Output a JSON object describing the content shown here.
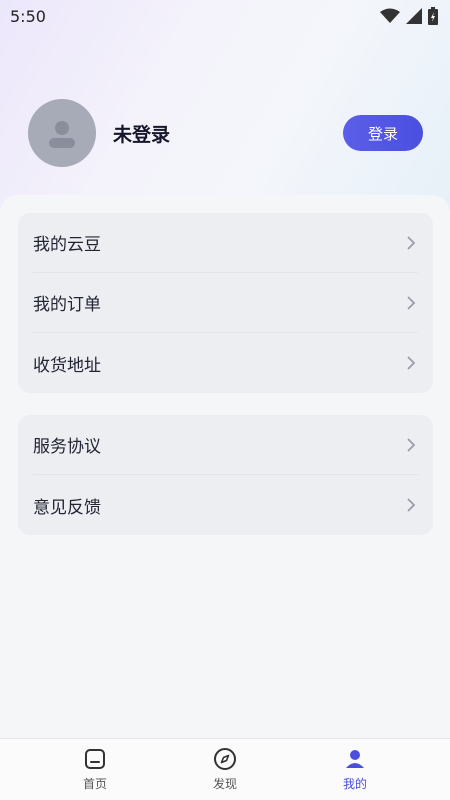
{
  "status": {
    "time": "5:50"
  },
  "profile": {
    "name": "未登录",
    "login_label": "登录"
  },
  "menu_group_1": [
    {
      "label": "我的云豆"
    },
    {
      "label": "我的订单"
    },
    {
      "label": "收货地址"
    }
  ],
  "menu_group_2": [
    {
      "label": "服务协议"
    },
    {
      "label": "意见反馈"
    }
  ],
  "tabs": [
    {
      "label": "首页",
      "icon": "home-icon"
    },
    {
      "label": "发现",
      "icon": "compass-icon"
    },
    {
      "label": "我的",
      "icon": "user-icon"
    }
  ],
  "colors": {
    "accent": "#4b4fe0",
    "avatar": "#a7aab7",
    "card": "#eceef2"
  }
}
